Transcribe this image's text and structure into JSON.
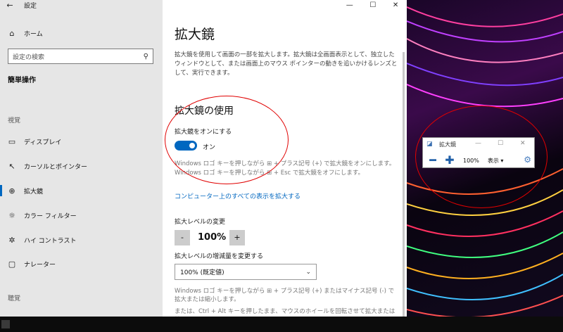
{
  "window": {
    "back_icon": "back-arrow-icon",
    "title": "設定",
    "controls": [
      "—",
      "☐",
      "✕"
    ]
  },
  "sidebar": {
    "home_label": "ホーム",
    "search_placeholder": "設定の検索",
    "category": "簡単操作",
    "groups": {
      "vision": "視覚",
      "hearing": "聴覚"
    },
    "items": [
      {
        "label": "ディスプレイ",
        "icon": "monitor-icon"
      },
      {
        "label": "カーソルとポインター",
        "icon": "pointer-icon"
      },
      {
        "label": "拡大鏡",
        "icon": "magnifier-icon",
        "active": true
      },
      {
        "label": "カラー フィルター",
        "icon": "color-filter-icon"
      },
      {
        "label": "ハイ コントラスト",
        "icon": "contrast-icon"
      },
      {
        "label": "ナレーター",
        "icon": "narrator-icon"
      }
    ]
  },
  "main": {
    "title": "拡大鏡",
    "description": "拡大鏡を使用して画面の一部を拡大します。拡大鏡は全画面表示として、独立したウィンドウとして、または画面上のマウス ポインターの動きを追いかけるレンズとして、実行できます。",
    "section_title": "拡大鏡の使用",
    "toggle_label": "拡大鏡をオンにする",
    "toggle_state": "オン",
    "hint_on": "Windows ロゴ キーを押しながら ⊞ + プラス記号 (+) で拡大鏡をオンにします。",
    "hint_off": "Windows ロゴ キーを押しながら ⊞ + Esc で拡大鏡をオフにします。",
    "link": "コンピューター上のすべての表示を拡大する",
    "zoom_label": "拡大レベルの変更",
    "zoom_minus": "-",
    "zoom_value": "100%",
    "zoom_plus": "+",
    "increment_label": "拡大レベルの増減量を変更する",
    "increment_value": "100% (既定値)",
    "hint_zoom_1": "Windows ロゴ キーを押しながら ⊞ + プラス記号 (+) またはマイナス記号 (-) で拡大または縮小します。",
    "hint_zoom_2": "または、Ctrl + Alt キーを押したまま、マウスのホイールを回転させて拡大または縮"
  },
  "magnifier_window": {
    "title": "拡大鏡",
    "zoom": "100%",
    "view_menu": "表示 ▾",
    "minus": "━",
    "plus": "✚"
  },
  "colors": {
    "accent": "#0067c0",
    "annotation": "#e00000"
  }
}
